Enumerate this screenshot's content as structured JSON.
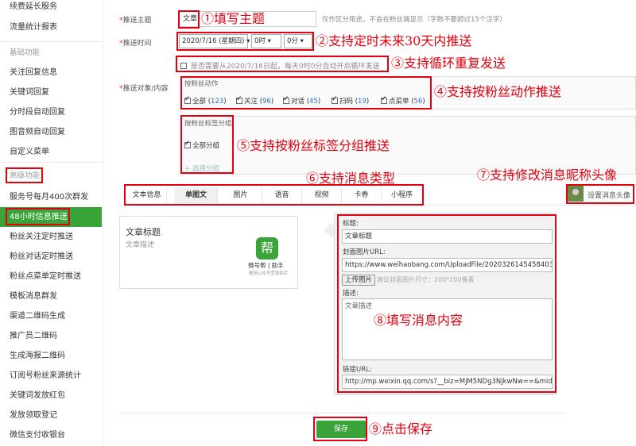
{
  "sidebar": {
    "items": [
      "续费延长服务",
      "流量统计报表",
      "基础功能",
      "关注回复信息",
      "关键词回复",
      "分时段自动回复",
      "图音频自动回复",
      "自定义菜单",
      "高级功能",
      "服务号每月400次群发",
      "48小时信息推送",
      "粉丝关注定时推送",
      "粉丝对话定时推送",
      "粉丝点菜单定时推送",
      "模板消息群发",
      "渠道二维码生成",
      "推广员二维码",
      "生成海报二维码",
      "订阅号粉丝来源统计",
      "关键词发放红包",
      "发放领取登记",
      "微信支付收银台"
    ]
  },
  "form": {
    "topic_label": "推送主题",
    "topic_value": "文章",
    "topic_hint": "仅作区分用途，不会在粉丝端显示（字数不要超过15个汉字）",
    "time_label": "推送时间",
    "date_value": "2020/7/16 (星期四) ▾",
    "hour_value": "0时 ▾",
    "minute_value": "0分 ▾",
    "repeat_label": "是否需要从2020/7/16日起，每天0时0分自动开启循环发送",
    "target_label": "推送对象/内容",
    "fan_action_title": "按粉丝动作",
    "fan_actions": [
      {
        "label": "全部",
        "count": "123"
      },
      {
        "label": "关注",
        "count": "96"
      },
      {
        "label": "对话",
        "count": "45"
      },
      {
        "label": "扫码",
        "count": "19"
      },
      {
        "label": "点菜单",
        "count": "56"
      }
    ],
    "tag_group_title": "按粉丝标签分组",
    "tag_all": "全部分组",
    "tag_select": "+ 选择分组"
  },
  "tabs": [
    "文本信息",
    "单图文",
    "图片",
    "语音",
    "视频",
    "卡券",
    "小程序"
  ],
  "avatar_setting": "设置消息头像",
  "preview": {
    "title": "文章标题",
    "desc": "文章描述",
    "logo_char": "帮",
    "logo_name": "微号帮 | 助手",
    "logo_sub": "微信公众号营销助手"
  },
  "editor": {
    "title_label": "标题:",
    "title_value": "文章标题",
    "cover_label": "封面图片URL:",
    "cover_value": "https://www.weihaobang.com/UploadFile/20203261454584039",
    "upload_btn": "上传图片",
    "upload_hint": "建议封面图片尺寸：200*200像素",
    "desc_label": "描述:",
    "desc_value": "文章描述",
    "link_label": "链接URL:",
    "link_value": "http://mp.weixin.qq.com/s?__biz=MjM5NDg3NjkwNw==&mid="
  },
  "save_label": "保存",
  "annotations": {
    "a1": "①填写主题",
    "a2": "②支持定时未来30天内推送",
    "a3": "③支持循环重复发送",
    "a4": "④支持按粉丝动作推送",
    "a5": "⑤支持按粉丝标签分组推送",
    "a6": "⑥支持消息类型",
    "a7": "⑦支持修改消息昵称头像",
    "a8": "⑧填写消息内容",
    "a9": "⑨点击保存"
  },
  "colors": {
    "accent": "#3aa33a",
    "annotation": "#e3000f"
  }
}
